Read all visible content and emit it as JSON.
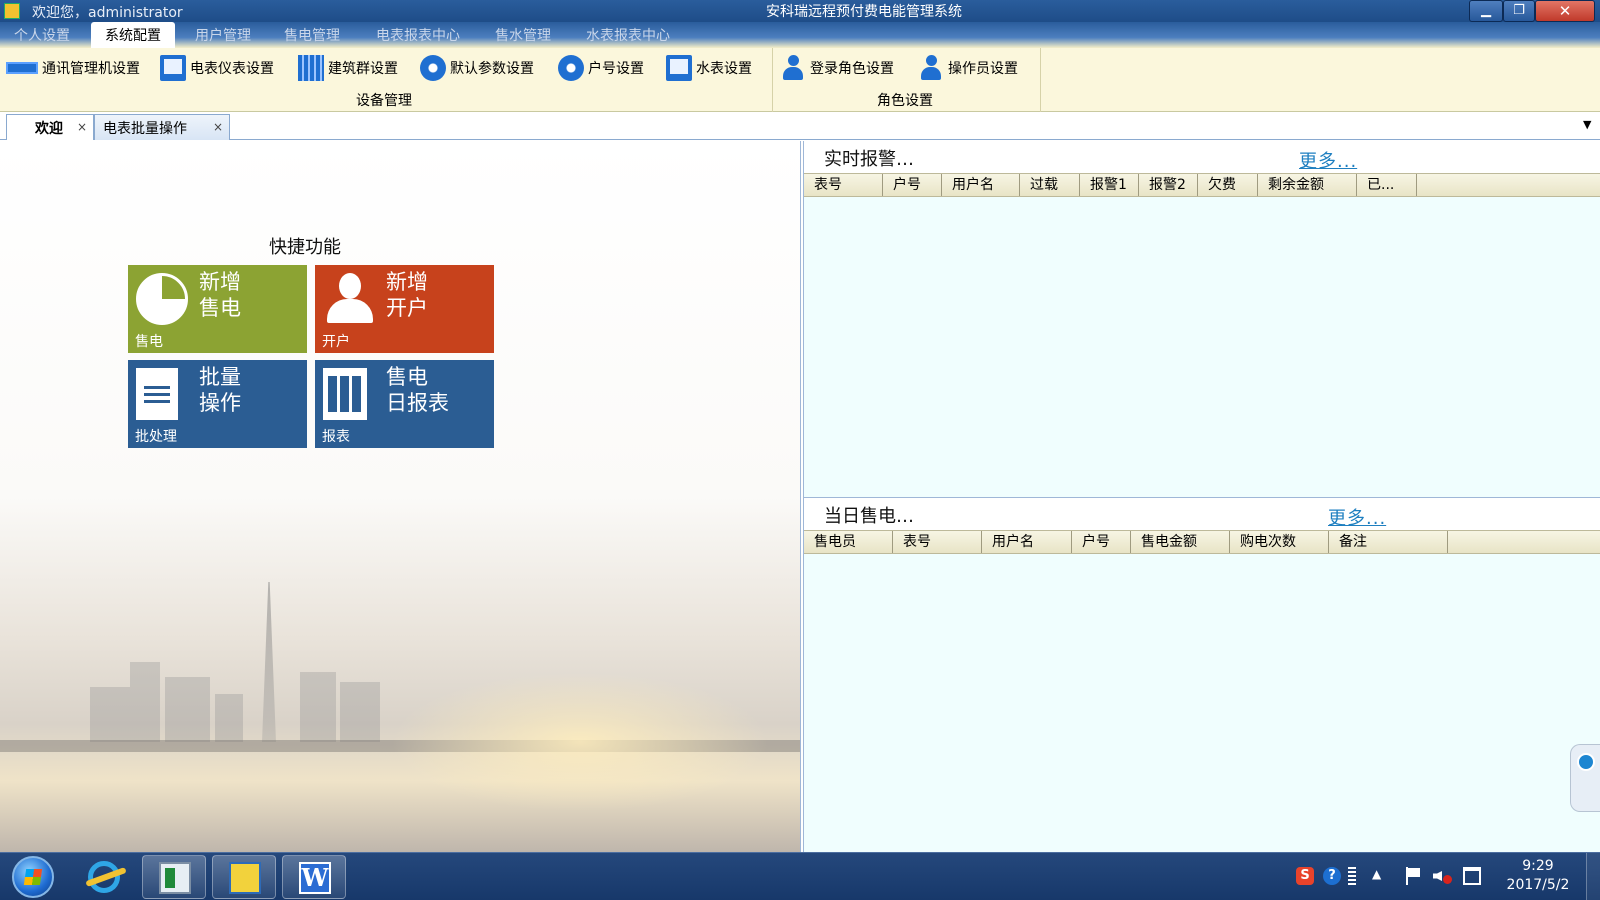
{
  "window": {
    "welcome": "欢迎您，administrator",
    "title": "安科瑞远程预付费电能管理系统",
    "controls": {
      "minimize": "▁",
      "maximize": "❐",
      "close": "✕"
    }
  },
  "menu": {
    "items": [
      {
        "label": "个人设置",
        "active": false
      },
      {
        "label": "系统配置",
        "active": true
      },
      {
        "label": "用户管理",
        "active": false
      },
      {
        "label": "售电管理",
        "active": false
      },
      {
        "label": "电表报表中心",
        "active": false
      },
      {
        "label": "售水管理",
        "active": false
      },
      {
        "label": "水表报表中心",
        "active": false
      }
    ]
  },
  "ribbon": {
    "groups": [
      {
        "label": "设备管理",
        "buttons": [
          {
            "label": "通讯管理机设置",
            "icon": "comm-manager-icon"
          },
          {
            "label": "电表仪表设置",
            "icon": "meter-icon"
          },
          {
            "label": "建筑群设置",
            "icon": "building-icon"
          },
          {
            "label": "默认参数设置",
            "icon": "gear-icon"
          },
          {
            "label": "户号设置",
            "icon": "household-icon"
          },
          {
            "label": "水表设置",
            "icon": "water-meter-icon"
          }
        ]
      },
      {
        "label": "角色设置",
        "buttons": [
          {
            "label": "登录角色设置",
            "icon": "login-role-icon"
          },
          {
            "label": "操作员设置",
            "icon": "operator-icon"
          }
        ]
      }
    ]
  },
  "doc_tabs": {
    "tabs": [
      {
        "label": "欢迎",
        "active": true
      },
      {
        "label": "电表批量操作",
        "active": false
      }
    ],
    "close_glyph": "×",
    "dropdown_glyph": "▼"
  },
  "quick": {
    "title": "快捷功能",
    "tiles": [
      {
        "main_line1": "新增",
        "main_line2": "售电",
        "sub": "售电",
        "color": "#8ca333",
        "icon": "pie-chart-icon"
      },
      {
        "main_line1": "新增",
        "main_line2": "开户",
        "sub": "开户",
        "color": "#c7421c",
        "icon": "user-icon"
      },
      {
        "main_line1": "批量",
        "main_line2": "操作",
        "sub": "批处理",
        "color": "#2b5d93",
        "icon": "document-icon"
      },
      {
        "main_line1": "售电",
        "main_line2": "日报表",
        "sub": "报表",
        "color": "#2b5d93",
        "icon": "report-book-icon"
      }
    ]
  },
  "alarm_panel": {
    "title": "实时报警…",
    "more": "更多...",
    "columns": [
      "表号",
      "户号",
      "用户名",
      "过载",
      "报警1",
      "报警2",
      "欠费",
      "剩余金额",
      "已..."
    ],
    "rows": []
  },
  "sales_panel": {
    "title": "当日售电…",
    "more": "更多...",
    "columns": [
      "售电员",
      "表号",
      "用户名",
      "户号",
      "售电金额",
      "购电次数",
      "备注"
    ],
    "rows": []
  },
  "taskbar": {
    "apps": [
      {
        "name": "internet-explorer",
        "open": false
      },
      {
        "name": "prepaid-meter-app",
        "open": false
      },
      {
        "name": "remote-tool",
        "open": true
      },
      {
        "name": "word",
        "open": false,
        "glyph": "W"
      }
    ],
    "tray": {
      "sogou": "S",
      "help": "?",
      "chevron": "▲"
    },
    "clock_time": "9:29",
    "clock_date": "2017/5/2"
  },
  "colors": {
    "title_bar": "#1d4b86",
    "ribbon_bg": "#fbf7dc",
    "panel_bg": "#f0fefe",
    "link": "#1e7fc0"
  }
}
